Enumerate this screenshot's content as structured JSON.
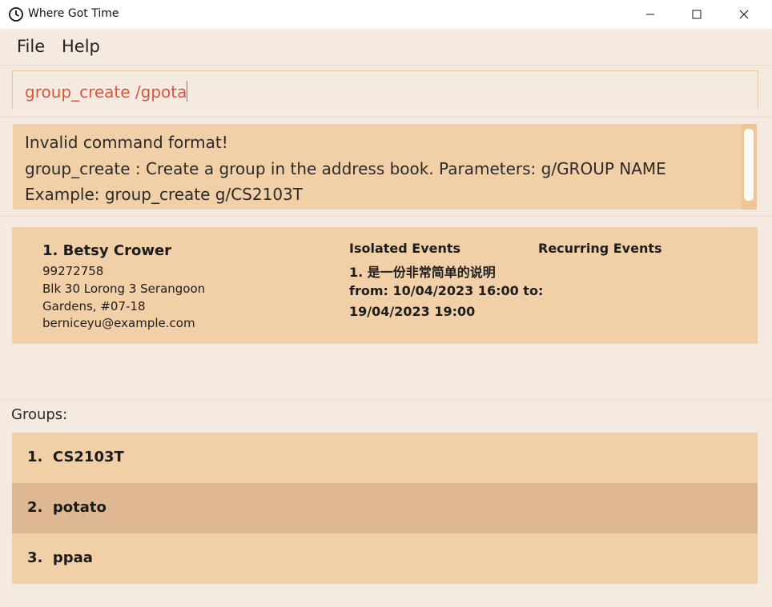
{
  "window": {
    "title": "Where Got Time",
    "icon": "clock-icon",
    "controls": [
      "minimize-icon",
      "maximize-icon",
      "close-icon"
    ]
  },
  "menu": {
    "file": "File",
    "help": "Help"
  },
  "command_box": {
    "value": "group_create /gpota"
  },
  "result_display": {
    "lines": [
      "Invalid command format!",
      "group_create : Create a group in the address book. Parameters: g/GROUP NAME",
      "Example: group_create g/CS2103T"
    ]
  },
  "person": {
    "name": "1. Betsy Crower",
    "phone": "99272758",
    "address_line1": "Blk 30 Lorong 3 Serangoon",
    "address_line2": "Gardens, #07-18",
    "email": "berniceyu@example.com",
    "isolated_events_heading": "Isolated Events",
    "recurring_events_heading": "Recurring Events",
    "isolated_event_lines": [
      "1. 是一份非常简单的说明",
      "from: 10/04/2023 16:00 to:",
      "19/04/2023 19:00"
    ]
  },
  "groups": {
    "label": "Groups:",
    "items": [
      {
        "label": "1.  CS2103T",
        "selected": false
      },
      {
        "label": "2.  potato",
        "selected": true
      },
      {
        "label": "3.  ppaa",
        "selected": false
      }
    ]
  },
  "colors": {
    "background": "#f5eae0",
    "card": "#f1cfa7",
    "selected_row": "#ddb893",
    "command_text": "#d9553d"
  }
}
